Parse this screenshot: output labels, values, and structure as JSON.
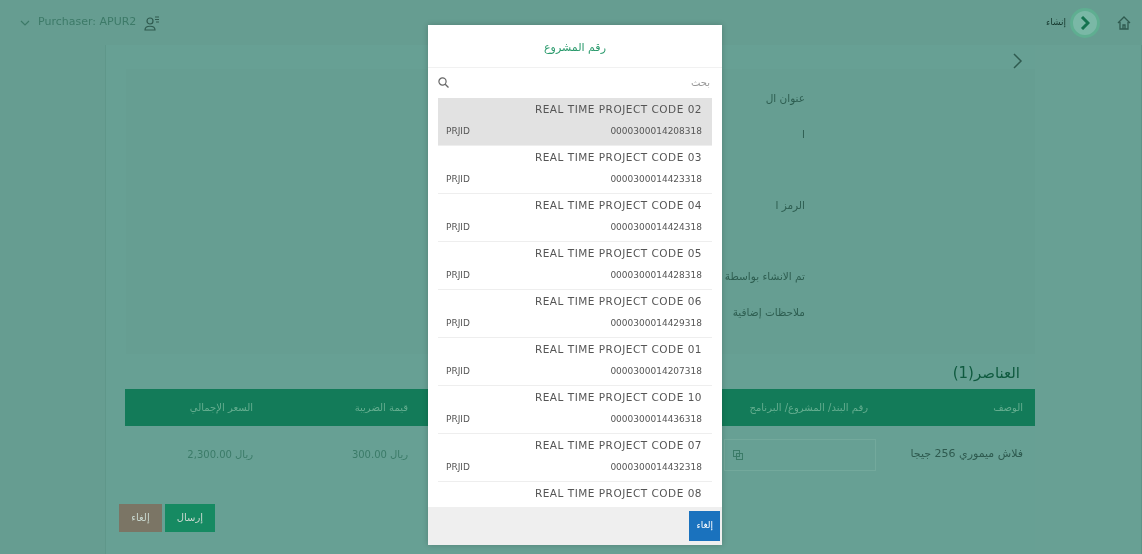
{
  "top_bar": {
    "user": "Purchaser: APUR2",
    "step_label": "إنشاء"
  },
  "form": {
    "fields": [
      {
        "label": "عنوان ال"
      },
      {
        "label": "ا"
      },
      {
        "label": "الرمز ا"
      },
      {
        "label": "تم الانشاء بواسطة"
      },
      {
        "label": "ملاحظات إضافية"
      }
    ]
  },
  "items": {
    "title": "العناصر(1)",
    "columns": [
      "الوصف",
      "رقم البند/ المشروع/ البرنامج",
      "",
      "قيمة الضريبة",
      "السعر الإجمالي"
    ],
    "rows": [
      {
        "cells": [
          "فلاش ميموري 256 جيجا",
          "",
          "",
          "ريال 300.00",
          "ريال 2,300.00"
        ]
      }
    ]
  },
  "actions": [
    {
      "label": "إرسال",
      "kind": "submit"
    },
    {
      "label": "إلغاء",
      "kind": "cancel"
    }
  ],
  "modal": {
    "title": "رقم المشروع",
    "search": {
      "placeholder": "بحث"
    },
    "options": [
      {
        "name": "REAL TIME PROJECT CODE 02",
        "code": "0000300014208318",
        "tag": "PRJID",
        "selected": true
      },
      {
        "name": "REAL TIME PROJECT CODE 03",
        "code": "0000300014423318",
        "tag": "PRJID",
        "selected": false
      },
      {
        "name": "REAL TIME PROJECT CODE 04",
        "code": "0000300014424318",
        "tag": "PRJID",
        "selected": false
      },
      {
        "name": "REAL TIME PROJECT CODE 05",
        "code": "0000300014428318",
        "tag": "PRJID",
        "selected": false
      },
      {
        "name": "REAL TIME PROJECT CODE 06",
        "code": "0000300014429318",
        "tag": "PRJID",
        "selected": false
      },
      {
        "name": "REAL TIME PROJECT CODE 01",
        "code": "0000300014207318",
        "tag": "PRJID",
        "selected": false
      },
      {
        "name": "REAL TIME PROJECT CODE 10",
        "code": "0000300014436318",
        "tag": "PRJID",
        "selected": false
      },
      {
        "name": "REAL TIME PROJECT CODE 07",
        "code": "0000300014432318",
        "tag": "PRJID",
        "selected": false
      },
      {
        "name": "REAL TIME PROJECT CODE 08",
        "selected": false
      }
    ],
    "buttons": [
      {
        "label": "إلغاء"
      }
    ]
  }
}
